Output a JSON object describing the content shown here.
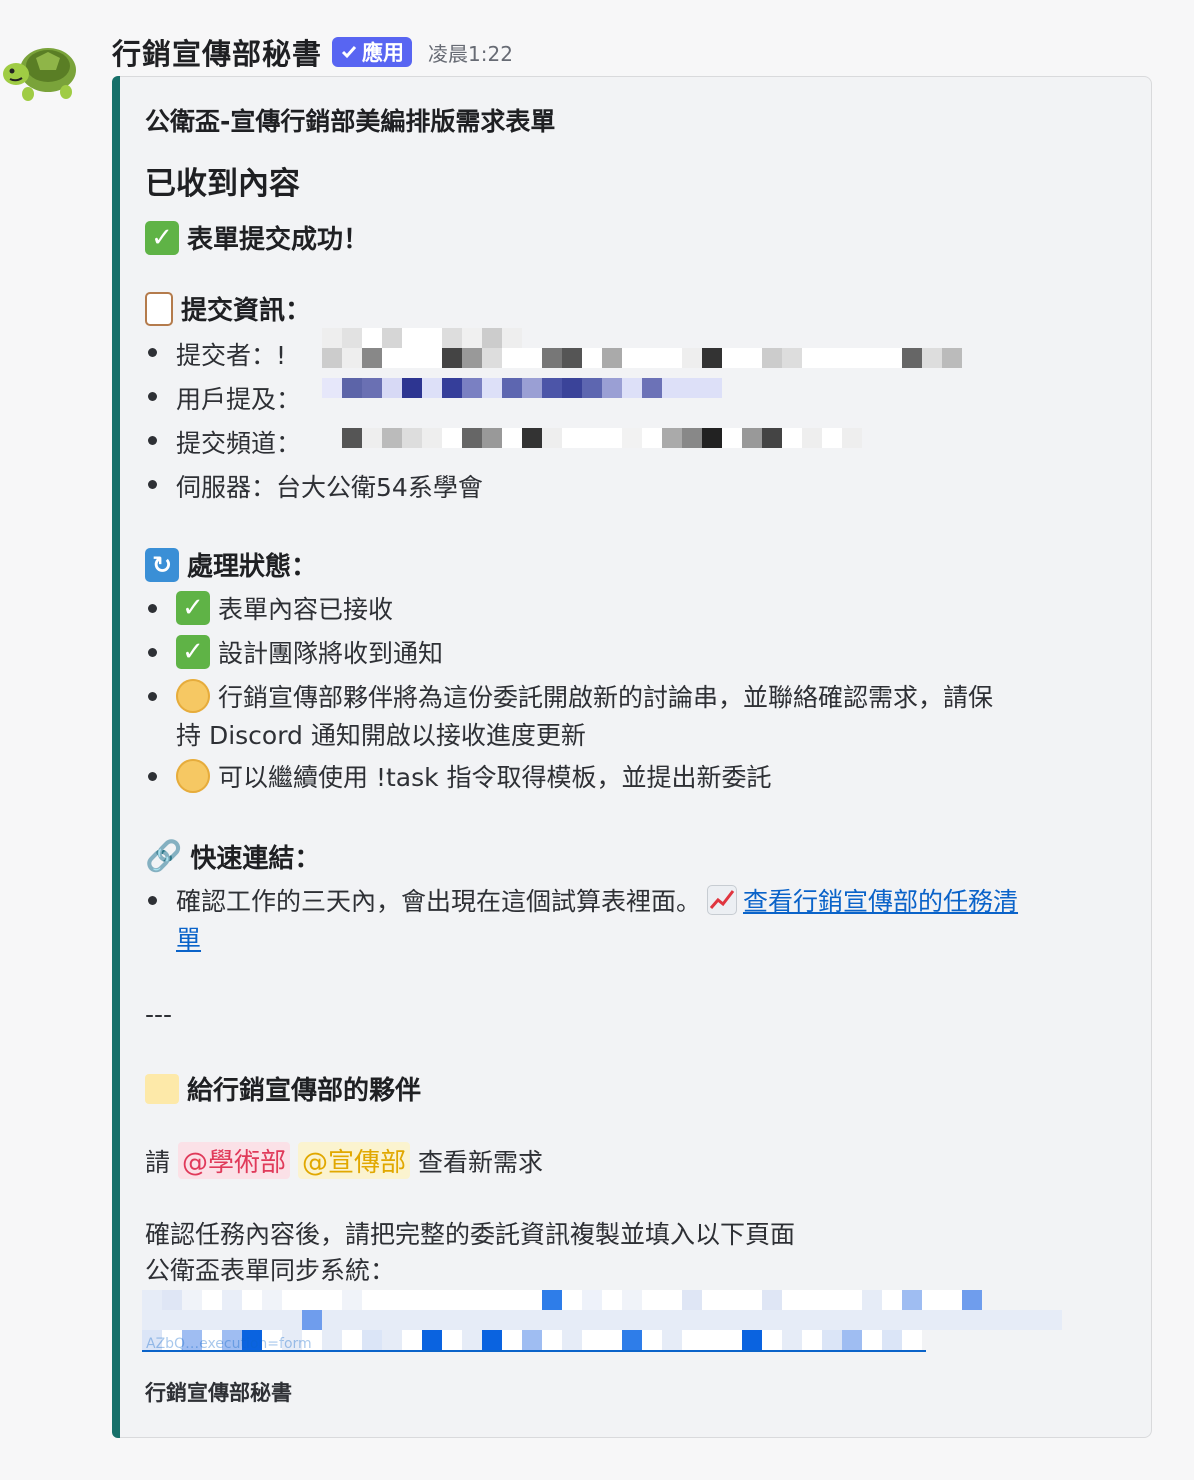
{
  "message": {
    "author": "行銷宣傳部秘書",
    "app_badge": "應用",
    "timestamp": "凌晨1:22",
    "avatar_icon": "turtle-icon"
  },
  "embed": {
    "accent_color": "#17706a",
    "title": "公衛盃-宣傳行銷部美編排版需求表單",
    "heading": "已收到內容",
    "success_line": "表單提交成功！",
    "submit_info": {
      "title": "提交資訊：",
      "items": [
        {
          "label": "提交者：",
          "value": "!"
        },
        {
          "label": "用戶提及：",
          "value": ""
        },
        {
          "label": "提交頻道：",
          "value": ""
        },
        {
          "label": "伺服器：",
          "value": "台大公衛54系學會"
        }
      ]
    },
    "status": {
      "title": "處理狀態：",
      "items": [
        {
          "icon": "check-icon",
          "text": "表單內容已接收"
        },
        {
          "icon": "check-icon",
          "text": "設計團隊將收到通知"
        },
        {
          "icon": "cookie-icon",
          "text_line1": "行銷宣傳部夥伴將為這份委託開啟新的討論串，並聯絡確認需求，請保",
          "text_line2": "持 Discord 通知開啟以接收進度更新"
        },
        {
          "icon": "cookie-icon",
          "text": "可以繼續使用 !task 指令取得模板，並提出新委託"
        }
      ]
    },
    "quick_links": {
      "title": "快速連結：",
      "item_text": "確認工作的三天內，會出現在這個試算表裡面。",
      "link_text_line1": "查看行銷宣傳部的任務清",
      "link_text_line2": "單"
    },
    "divider": "---",
    "partners": {
      "title": "給行銷宣傳部的夥伴",
      "request_prefix": "請",
      "mention_academic": "@學術部",
      "mention_promo": "@宣傳部",
      "request_suffix": "查看新需求",
      "instruction_line1": "確認任務內容後，請把完整的委託資訊複製並填入以下頁面",
      "instruction_line2": "公衛盃表單同步系統：",
      "url_tail": "AZbQ…execution=form"
    },
    "footer": "行銷宣傳部秘書"
  }
}
